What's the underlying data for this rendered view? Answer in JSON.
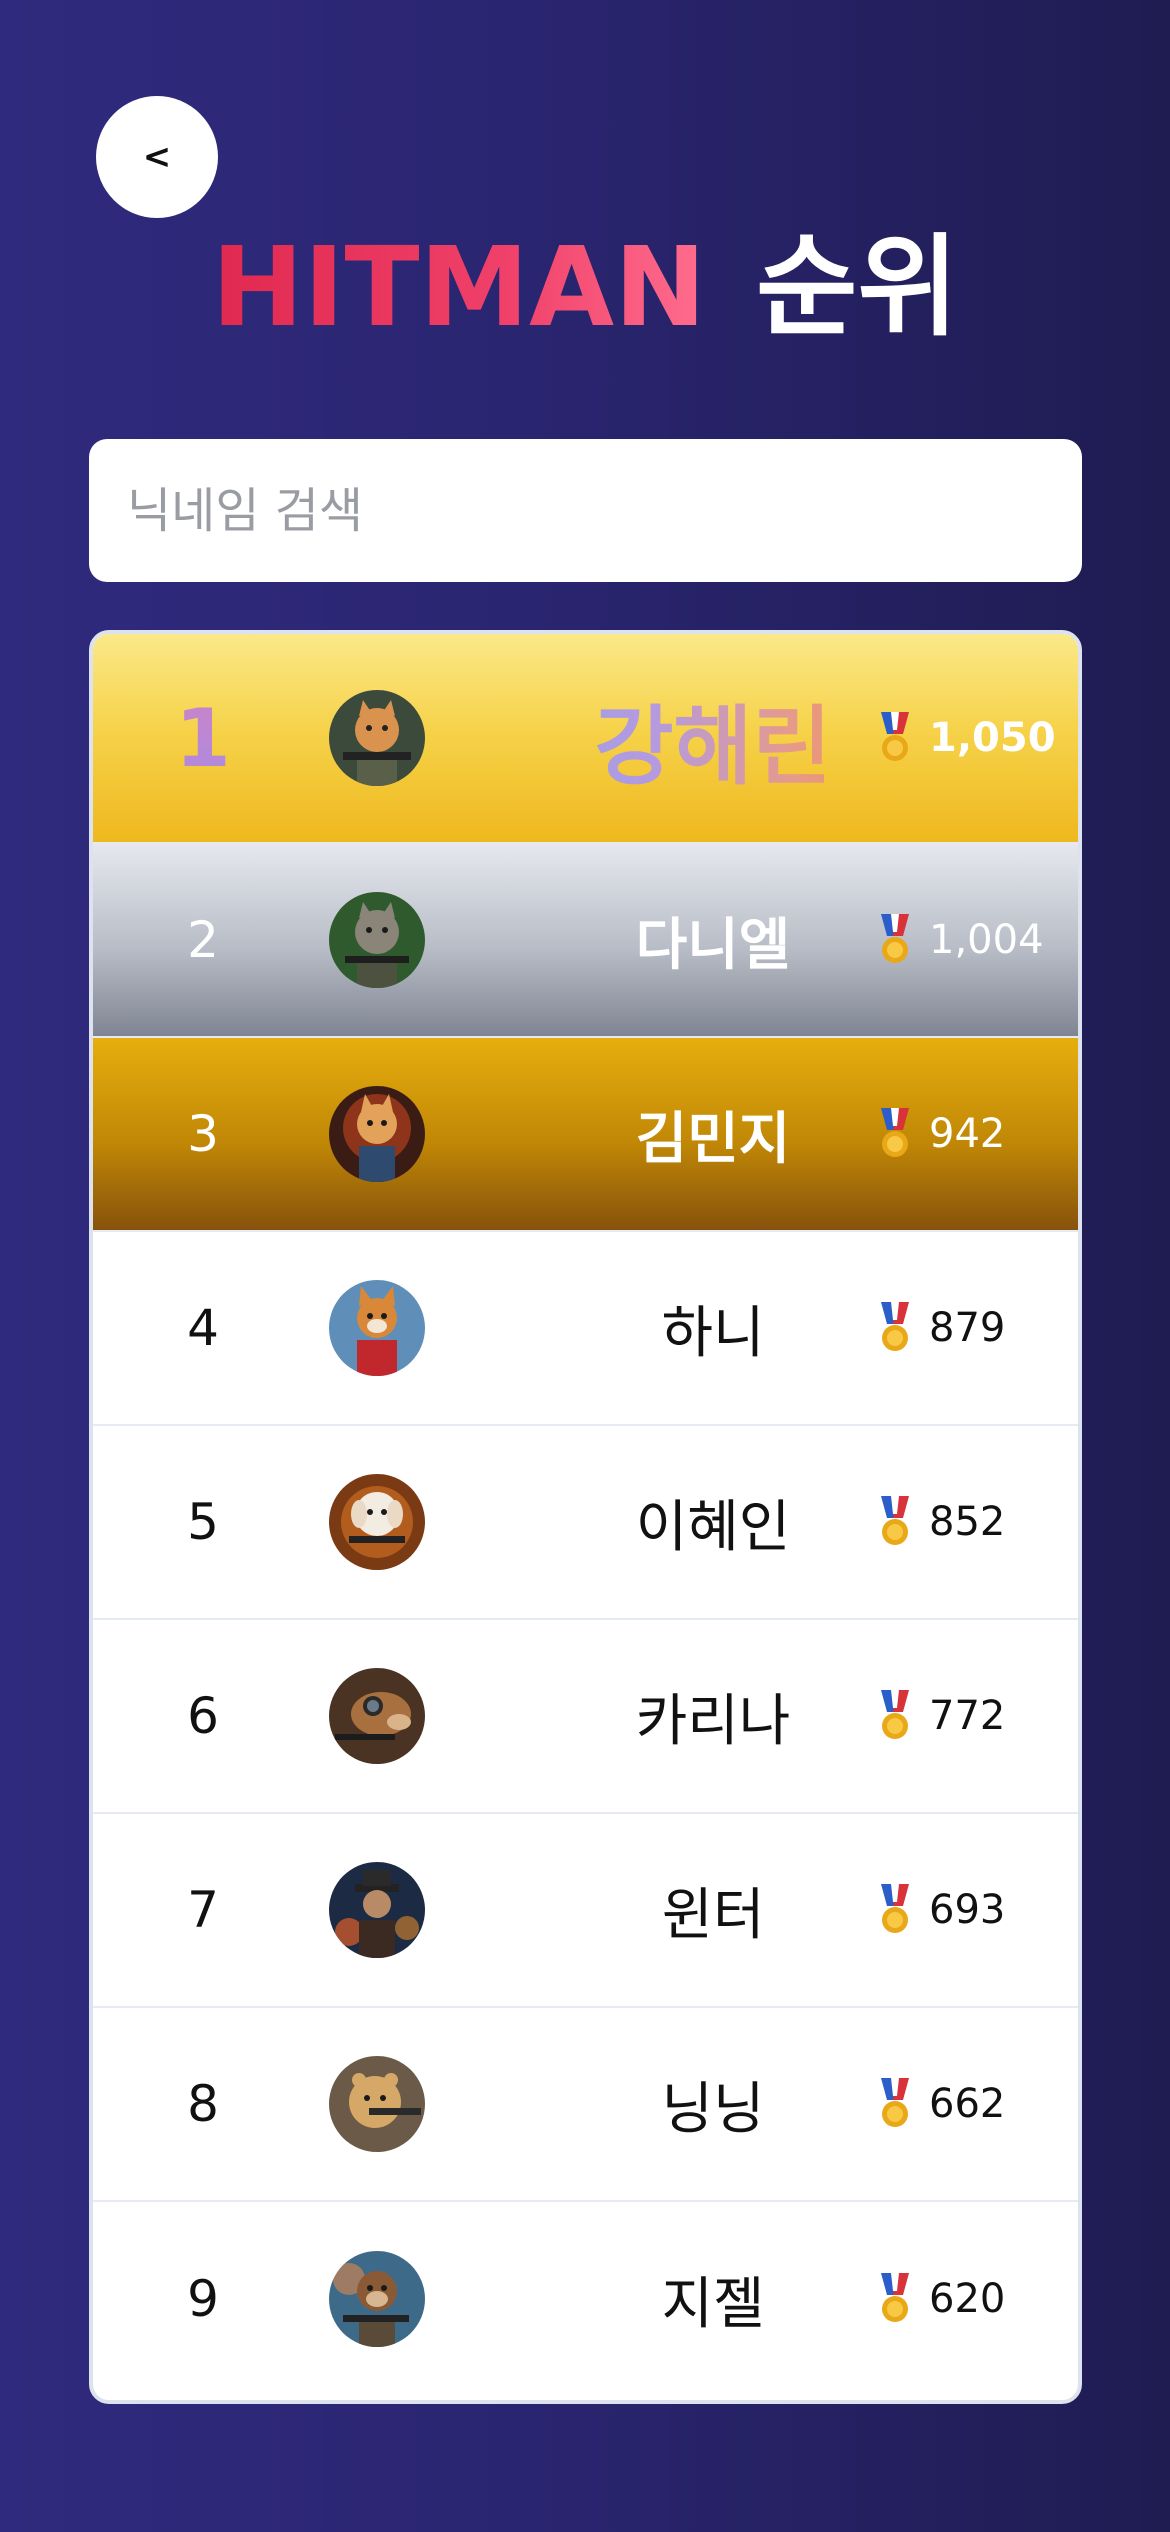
{
  "header": {
    "back_label": "<",
    "title_brand": "HITMAN",
    "title_rank": "순위"
  },
  "search": {
    "placeholder": "닉네임 검색"
  },
  "colors": {
    "gold": "#f4c831",
    "silver": "#a9afb9",
    "bronze": "#b77a09",
    "brand": "#ee3b63",
    "background": "#2a2570"
  },
  "leaderboard": {
    "rows": [
      {
        "rank": "1",
        "name": "강해린",
        "score": "1,050",
        "avatar_icon": "cat-soldier-avatar",
        "tier": "gold"
      },
      {
        "rank": "2",
        "name": "다니엘",
        "score": "1,004",
        "avatar_icon": "cat-soldier-avatar",
        "tier": "silver"
      },
      {
        "rank": "3",
        "name": "김민지",
        "score": "942",
        "avatar_icon": "kitten-gunner-avatar",
        "tier": "bronze"
      },
      {
        "rank": "4",
        "name": "하니",
        "score": "879",
        "avatar_icon": "fox-soldier-avatar",
        "tier": "normal"
      },
      {
        "rank": "5",
        "name": "이혜인",
        "score": "852",
        "avatar_icon": "puppy-gunner-avatar",
        "tier": "normal"
      },
      {
        "rank": "6",
        "name": "카리나",
        "score": "772",
        "avatar_icon": "dog-sniper-avatar",
        "tier": "normal"
      },
      {
        "rank": "7",
        "name": "윈터",
        "score": "693",
        "avatar_icon": "hat-gunner-avatar",
        "tier": "normal"
      },
      {
        "rank": "8",
        "name": "닝닝",
        "score": "662",
        "avatar_icon": "hamster-gunner-avatar",
        "tier": "normal"
      },
      {
        "rank": "9",
        "name": "지젤",
        "score": "620",
        "avatar_icon": "otter-gunner-avatar",
        "tier": "normal"
      }
    ]
  }
}
